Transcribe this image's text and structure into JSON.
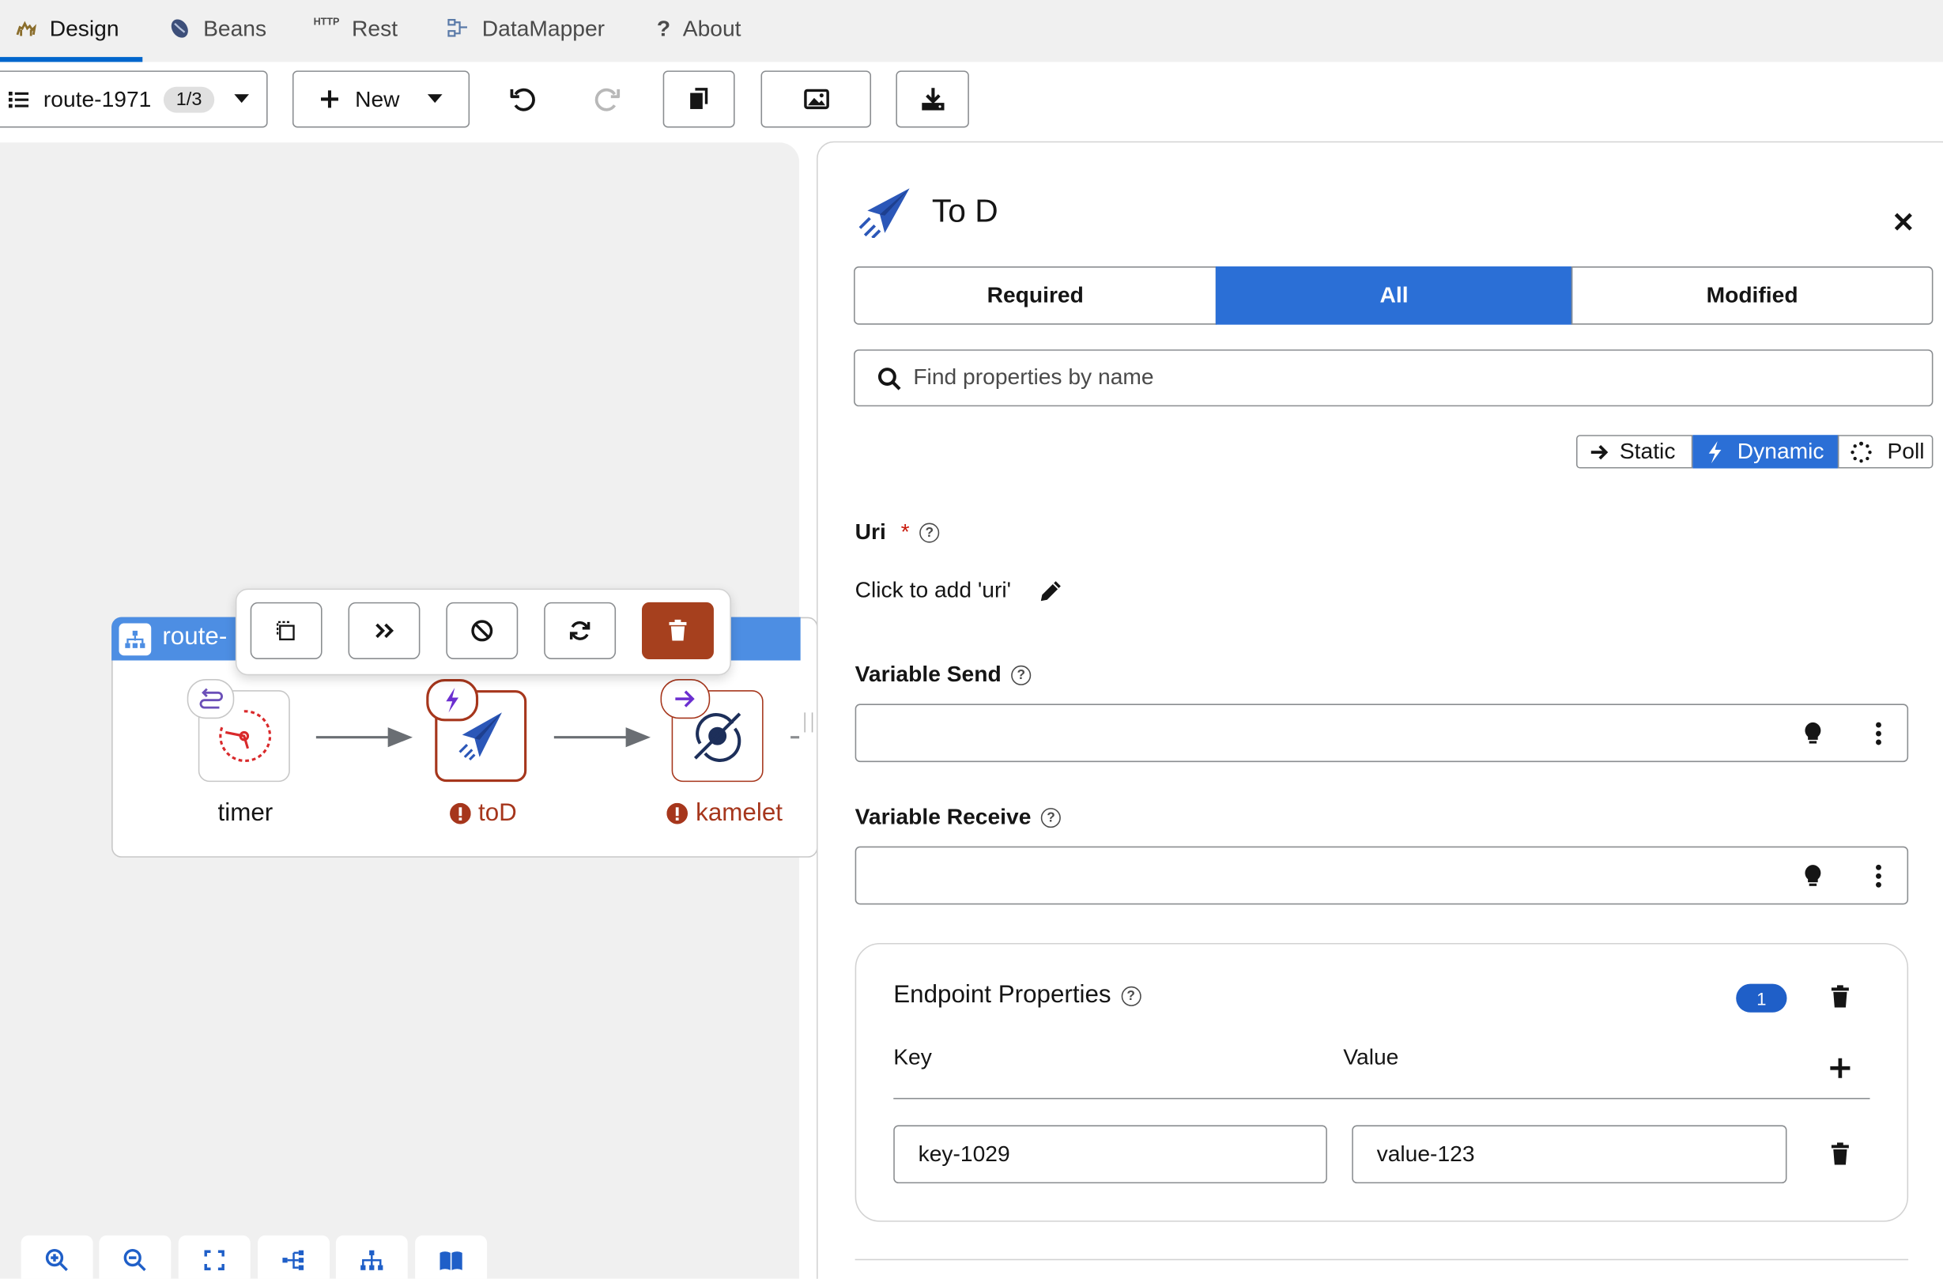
{
  "nav": {
    "tabs": [
      {
        "label": "Design",
        "icon": "camel-icon"
      },
      {
        "label": "Beans",
        "icon": "beans-icon"
      },
      {
        "label": "Rest",
        "icon": "http-icon",
        "icon_text": "HTTP"
      },
      {
        "label": "DataMapper",
        "icon": "datamapper-icon"
      },
      {
        "label": "About",
        "icon": "question-icon",
        "icon_text": "?"
      }
    ],
    "active": "Design"
  },
  "toolbar": {
    "route_name": "route-1971",
    "route_count": "1/3",
    "new_label": "New"
  },
  "canvas": {
    "route_title": "route-",
    "nodes": [
      {
        "label": "timer",
        "status": "ok"
      },
      {
        "label": "toD",
        "status": "error"
      },
      {
        "label": "kamelet",
        "status": "error"
      }
    ]
  },
  "panel": {
    "title": "To D",
    "filters": [
      "Required",
      "All",
      "Modified"
    ],
    "active_filter": "All",
    "search_placeholder": "Find properties by name",
    "modes": [
      "Static",
      "Dynamic",
      "Poll"
    ],
    "active_mode": "Dynamic",
    "uri_label": "Uri",
    "uri_required_mark": "*",
    "uri_placeholder": "Click to add 'uri'",
    "variable_send_label": "Variable Send",
    "variable_send_value": "",
    "variable_receive_label": "Variable Receive",
    "variable_receive_value": "",
    "endpoint": {
      "title": "Endpoint Properties",
      "count": "1",
      "key_header": "Key",
      "value_header": "Value",
      "rows": [
        {
          "key": "key-1029",
          "value": "value-123"
        }
      ]
    }
  },
  "colors": {
    "accent": "#0066cc",
    "active_segment": "#2b6fd6",
    "route_header": "#4d8ee3",
    "error": "#a6361c",
    "delete_button": "#a6401e"
  }
}
